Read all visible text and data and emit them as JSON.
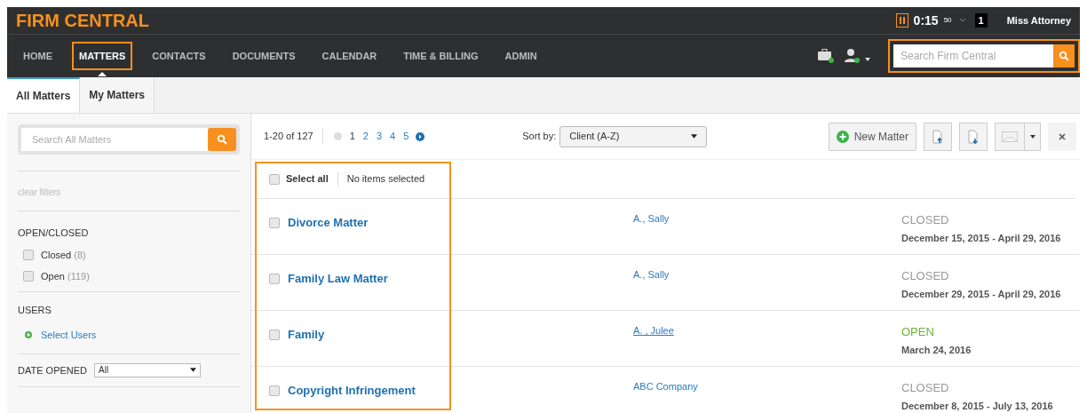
{
  "header": {
    "logo": "FIRM CENTRAL",
    "timer": {
      "paused": true,
      "time": "0:15",
      "seconds": "50"
    },
    "badge": "1",
    "user": "Miss Attorney"
  },
  "nav": {
    "items": [
      {
        "label": "HOME",
        "selected": false,
        "highlighted": false
      },
      {
        "label": "MATTERS",
        "selected": true,
        "highlighted": true
      },
      {
        "label": "CONTACTS",
        "selected": false,
        "highlighted": false
      },
      {
        "label": "DOCUMENTS",
        "selected": false,
        "highlighted": false
      },
      {
        "label": "CALENDAR",
        "selected": false,
        "highlighted": false
      },
      {
        "label": "TIME & BILLING",
        "selected": false,
        "highlighted": false
      },
      {
        "label": "ADMIN",
        "selected": false,
        "highlighted": false
      }
    ],
    "search": {
      "placeholder": "Search Firm Central",
      "highlighted": true
    }
  },
  "tabs": [
    {
      "label": "All Matters",
      "selected": true
    },
    {
      "label": "My Matters",
      "selected": false
    }
  ],
  "sidebar": {
    "search": {
      "placeholder": "Search All Matters"
    },
    "clear": "clear filters",
    "open_closed": {
      "title": "OPEN/CLOSED",
      "options": [
        {
          "label": "Closed",
          "count": "(8)",
          "checked": false
        },
        {
          "label": "Open",
          "count": "(119)",
          "checked": false
        }
      ]
    },
    "users": {
      "title": "USERS",
      "link": "Select Users"
    },
    "date_opened": {
      "title": "DATE OPENED",
      "value": "All"
    }
  },
  "toolbar": {
    "range": "1-20 of 127",
    "pages": [
      {
        "label": "1",
        "selected": true
      },
      {
        "label": "2",
        "selected": false
      },
      {
        "label": "3",
        "selected": false
      },
      {
        "label": "4",
        "selected": false
      },
      {
        "label": "5",
        "selected": false
      }
    ],
    "sort_label": "Sort by:",
    "sort_value": "Client (A-Z)",
    "new_button": "New Matter"
  },
  "list": {
    "highlighted": true,
    "select_all": "Select all",
    "select_all_checked": false,
    "selection_status": "No items selected",
    "rows": [
      {
        "name": "Divorce Matter",
        "client": "A., Sally",
        "client_underlined": false,
        "status": "CLOSED",
        "open": false,
        "dates": "December 15, 2015 - April 29, 2016",
        "checked": false
      },
      {
        "name": "Family Law Matter",
        "client": "A., Sally",
        "client_underlined": false,
        "status": "CLOSED",
        "open": false,
        "dates": "December 29, 2015 - April 29, 2016",
        "checked": false
      },
      {
        "name": "Family",
        "client": "A. , Julee",
        "client_underlined": true,
        "status": "OPEN",
        "open": true,
        "dates": "March 24, 2016",
        "checked": false
      },
      {
        "name": "Copyright Infringement",
        "client": "ABC Company",
        "client_underlined": false,
        "status": "CLOSED",
        "open": false,
        "dates": "December 8, 2015 - July 13, 2016",
        "checked": false
      }
    ]
  }
}
